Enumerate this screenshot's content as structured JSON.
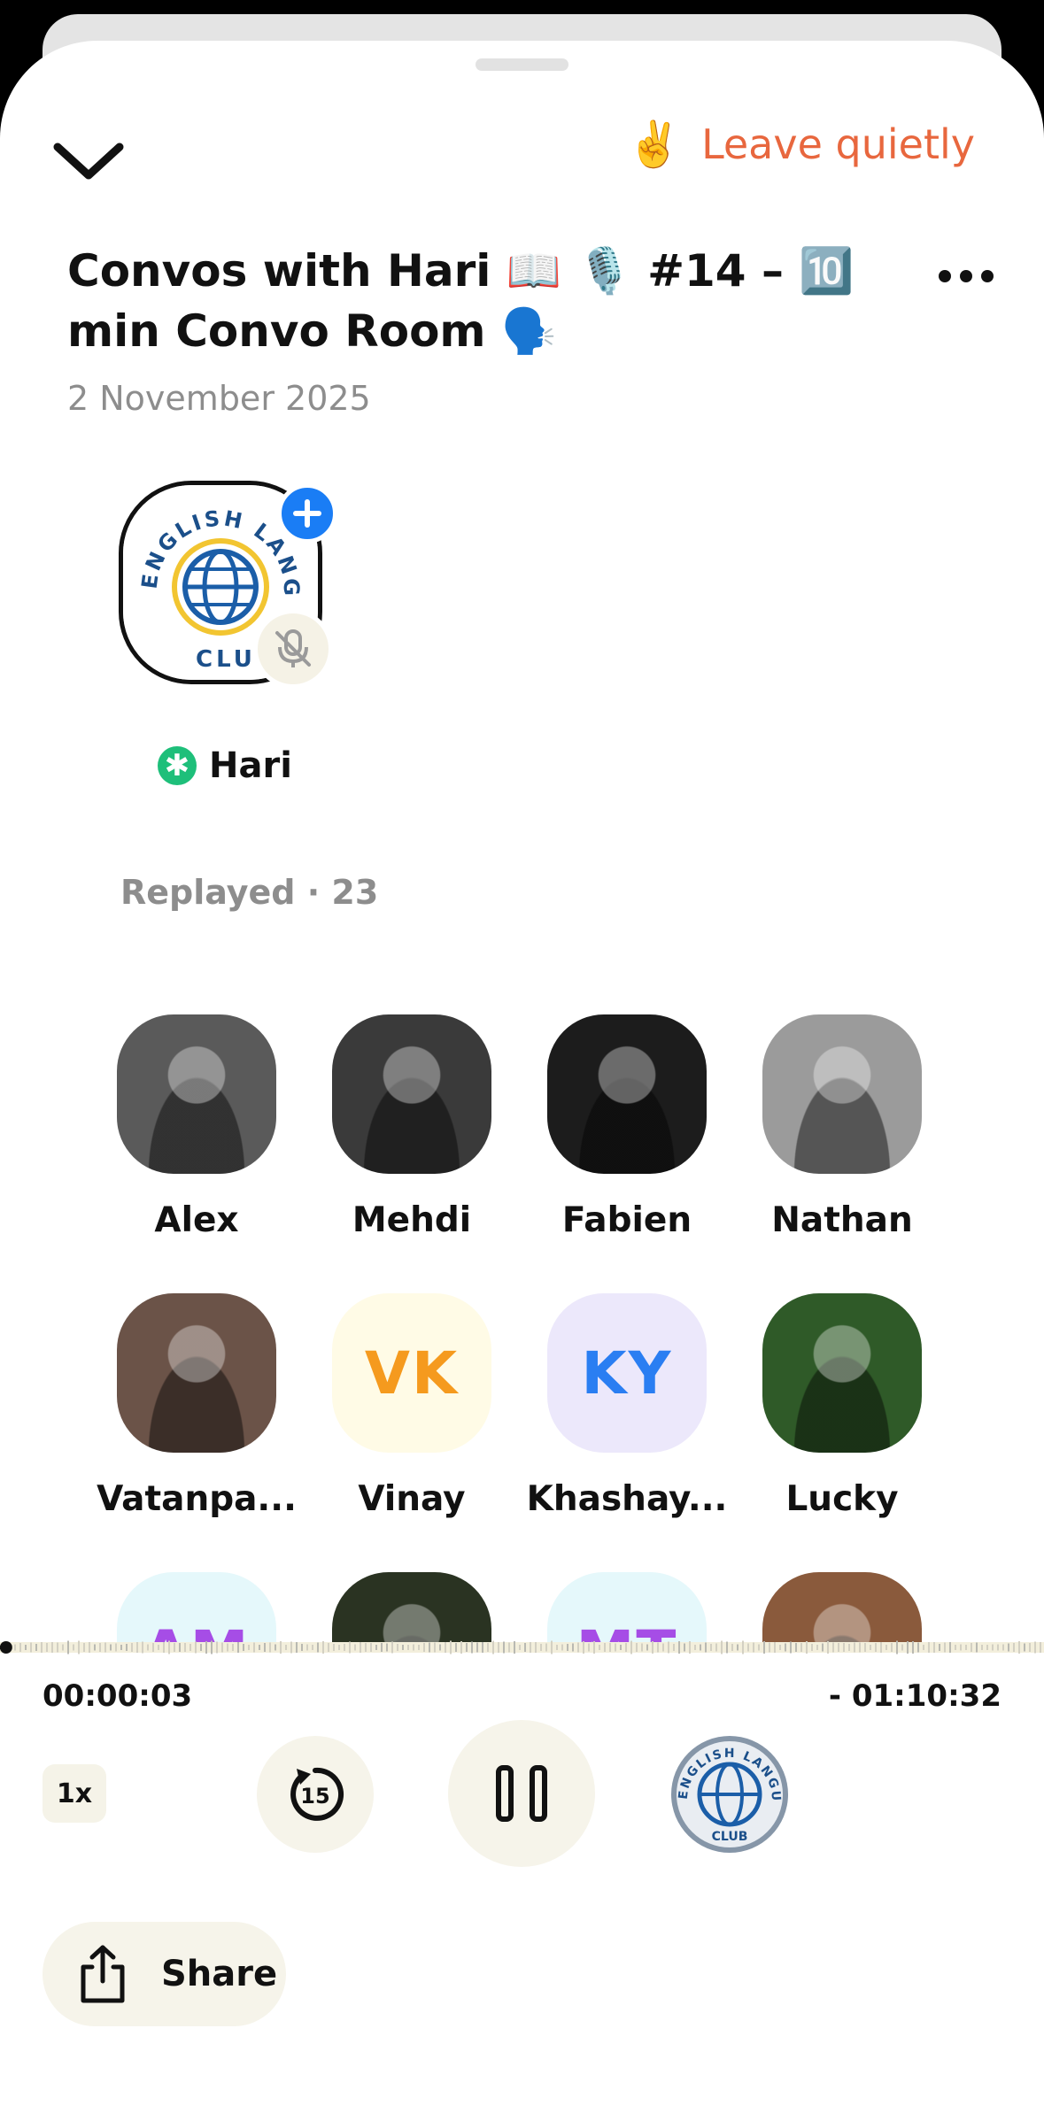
{
  "header": {
    "leave_label": "Leave quietly",
    "leave_emoji": "✌️"
  },
  "room": {
    "title": "Convos with Hari 📖 🎙️ #14 – 🔟 min Convo Room 🗣️",
    "date": "2 November 2025"
  },
  "host": {
    "name": "Hari",
    "logo_text": "ENGLISH LANGUAGE CLUB"
  },
  "replayed": {
    "label": "Replayed · 23"
  },
  "listeners": [
    {
      "name": "Alex",
      "initials": "",
      "bg": "#5a5a5a"
    },
    {
      "name": "Mehdi",
      "initials": "",
      "bg": "#3a3a3a"
    },
    {
      "name": "Fabien",
      "initials": "",
      "bg": "#1c1c1c"
    },
    {
      "name": "Nathan",
      "initials": "",
      "bg": "#9b9b9b"
    },
    {
      "name": "Vatanpa...",
      "initials": "",
      "bg": "#6b5348"
    },
    {
      "name": "Vinay",
      "initials": "VK",
      "bg": "#fffbe6",
      "fg": "#f59a1e"
    },
    {
      "name": "Khashay...",
      "initials": "KY",
      "bg": "#ece8fb",
      "fg": "#2a7ef2"
    },
    {
      "name": "Lucky",
      "initials": "",
      "bg": "#2f5a28"
    },
    {
      "name": "",
      "initials": "AM",
      "bg": "#e5f8fb",
      "fg": "#a64de6"
    },
    {
      "name": "",
      "initials": "",
      "bg": "#2a3322"
    },
    {
      "name": "",
      "initials": "MT",
      "bg": "#e5f8fb",
      "fg": "#a64de6"
    },
    {
      "name": "",
      "initials": "",
      "bg": "#8a5a3c"
    }
  ],
  "player": {
    "elapsed": "00:00:03",
    "remaining": "- 01:10:32",
    "speed": "1x",
    "skip_back_seconds": "15",
    "progress": 0.0007
  },
  "share": {
    "label": "Share"
  },
  "colors": {
    "accent": "#e8673e",
    "blue": "#1a7df5",
    "green": "#1ebf7a",
    "soft_bg": "#f6f4ea"
  }
}
